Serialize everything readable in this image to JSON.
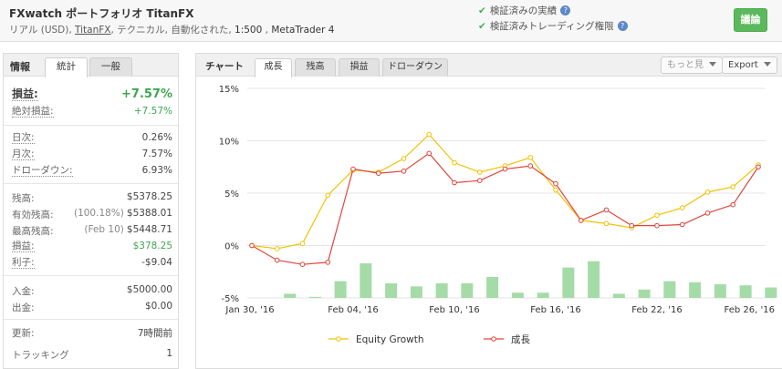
{
  "header": {
    "title": "FXwatch ポートフォリオ TitanFX",
    "subtitle": {
      "currency": "リアル (USD), ",
      "broker": "TitanFX",
      "details": ", テクニカル, 自動化された, ",
      "leverage": "1:500",
      "sep": " , ",
      "platform": "MetaTrader 4"
    },
    "verified_track": "検証済みの実績",
    "verified_privileges": "検証済みトレーディング権限",
    "help_icon": "?",
    "discuss_button": "議論"
  },
  "left_panel": {
    "label": "情報",
    "tabs": [
      "統計",
      "一般"
    ],
    "active_tab": "統計",
    "gain_label": "損益:",
    "gain_value": "+7.57%",
    "abs_gain_label": "絶対損益:",
    "abs_gain_value": "+7.57%",
    "daily_label": "日次:",
    "daily_value": "0.26%",
    "monthly_label": "月次:",
    "monthly_value": "7.57%",
    "drawdown_label": "ドローダウン:",
    "drawdown_value": "6.93%",
    "balance_label": "残高:",
    "balance_value": "$5378.25",
    "equity_label": "有効残高:",
    "equity_pre": "(100.18%)",
    "equity_value": "$5388.01",
    "highest_label": "最高残高:",
    "highest_pre": "(Feb 10)",
    "highest_value": "$5448.71",
    "profit_label": "損益:",
    "profit_value": "$378.25",
    "interest_label": "利子:",
    "interest_value": "-$9.04",
    "deposits_label": "入金:",
    "deposits_value": "$5000.00",
    "withdrawals_label": "出金:",
    "withdrawals_value": "$0.00",
    "updated_label": "更新:",
    "updated_value": "7時間前",
    "tracking_label": "トラッキング",
    "tracking_value": "1"
  },
  "right_panel": {
    "label": "チャート",
    "tabs": [
      "成長",
      "残高",
      "損益",
      "ドローダウン"
    ],
    "active_tab": "成長",
    "more_button": "もっと見",
    "export_button": "Export"
  },
  "colors": {
    "equity_line": "#f2c200",
    "growth_line": "#e0443a",
    "bars": "#a5dba7",
    "accent_green": "#3ea650"
  },
  "chart_data": {
    "type": "line",
    "x_tick_labels": [
      "Jan 30, '16",
      "Feb 04, '16",
      "Feb 10, '16",
      "Feb 16, '16",
      "Feb 22, '16",
      "Feb 26, '16"
    ],
    "y_tick_labels": [
      "15%",
      "10%",
      "5%",
      "0%",
      "-5%"
    ],
    "ylim": [
      -5,
      15
    ],
    "grid": "horizontal",
    "legend_placement": "bottom",
    "series": [
      {
        "name": "Equity Growth",
        "values": [
          0,
          -0.3,
          0.2,
          4.8,
          7.2,
          7.0,
          8.3,
          10.6,
          7.9,
          7.0,
          7.6,
          8.4,
          5.3,
          2.4,
          2.1,
          1.7,
          2.9,
          3.6,
          5.1,
          5.6,
          7.7
        ]
      },
      {
        "name": "成長",
        "values": [
          0,
          -1.4,
          -1.8,
          -1.6,
          7.3,
          6.9,
          7.1,
          8.8,
          6.0,
          6.2,
          7.3,
          7.6,
          5.9,
          2.4,
          3.4,
          1.9,
          1.9,
          2.0,
          3.1,
          3.9,
          7.5
        ]
      }
    ],
    "bars": [
      0,
      0.4,
      0.1,
      1.6,
      3.3,
      1.4,
      1.1,
      1.4,
      1.4,
      2.0,
      0.5,
      0.5,
      2.9,
      3.5,
      0.4,
      0.8,
      1.6,
      1.5,
      1.3,
      1.2,
      1.0
    ]
  }
}
